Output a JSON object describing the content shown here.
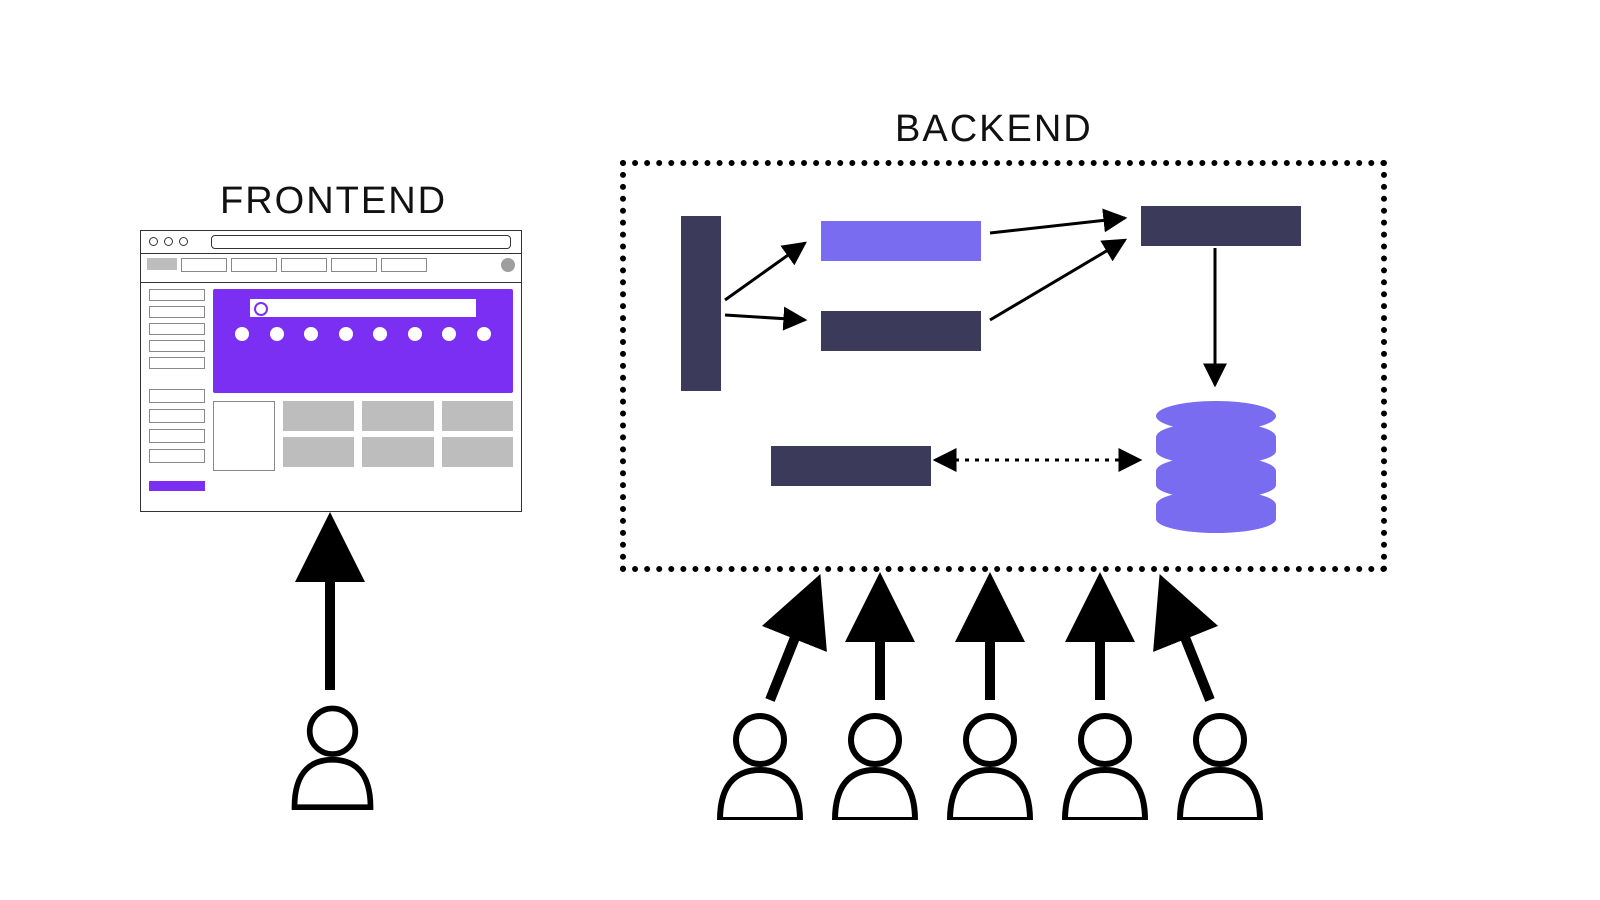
{
  "labels": {
    "frontend": "FRONTEND",
    "backend": "BACKEND"
  },
  "colors": {
    "accent_purple": "#7b2ff2",
    "service_light": "#7a6cf0",
    "service_dark": "#3b3a5a",
    "placeholder_gray": "#bdbdbd"
  },
  "frontend": {
    "hero_dot_count": 8,
    "nav_tab_count": 5,
    "sidebar_line_count": 5,
    "sidebar_lower_count": 4,
    "card_grid_cols": 3,
    "card_grid_rows": 2
  },
  "backend": {
    "services": [
      {
        "id": "gateway",
        "shape": "tall-bar",
        "color": "dark"
      },
      {
        "id": "service-a",
        "shape": "wide-bar",
        "color": "light"
      },
      {
        "id": "service-b",
        "shape": "wide-bar",
        "color": "dark"
      },
      {
        "id": "service-c",
        "shape": "wide-bar",
        "color": "dark"
      },
      {
        "id": "worker",
        "shape": "wide-bar",
        "color": "dark"
      },
      {
        "id": "database",
        "shape": "cylinder",
        "color": "light"
      }
    ],
    "connections": [
      {
        "from": "gateway",
        "to": "service-a",
        "style": "solid"
      },
      {
        "from": "gateway",
        "to": "service-b",
        "style": "solid"
      },
      {
        "from": "service-a",
        "to": "service-c",
        "style": "solid"
      },
      {
        "from": "service-b",
        "to": "service-c",
        "style": "solid"
      },
      {
        "from": "service-c",
        "to": "database",
        "style": "solid"
      },
      {
        "from": "worker",
        "to": "database",
        "style": "dotted-bidirectional"
      }
    ]
  },
  "actors": {
    "frontend_users": 1,
    "backend_users": 5
  }
}
